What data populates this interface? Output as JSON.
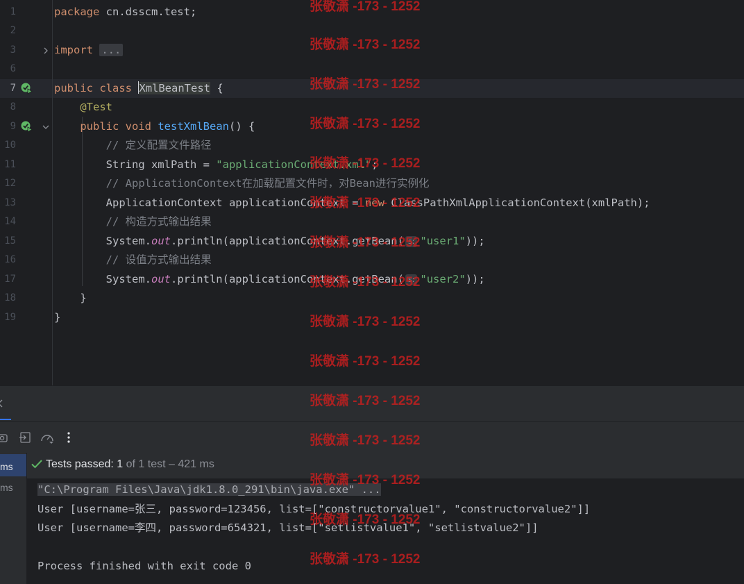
{
  "editor": {
    "lines": {
      "l1": {
        "num": "1"
      },
      "l2": {
        "num": "2"
      },
      "l3": {
        "num": "3"
      },
      "l6": {
        "num": "6"
      },
      "l7": {
        "num": "7"
      },
      "l8": {
        "num": "8"
      },
      "l9": {
        "num": "9"
      },
      "l10": {
        "num": "10"
      },
      "l11": {
        "num": "11"
      },
      "l12": {
        "num": "12"
      },
      "l13": {
        "num": "13"
      },
      "l14": {
        "num": "14"
      },
      "l15": {
        "num": "15"
      },
      "l16": {
        "num": "16"
      },
      "l17": {
        "num": "17"
      },
      "l18": {
        "num": "18"
      },
      "l19": {
        "num": "19"
      }
    },
    "code": {
      "package_kw": "package",
      "package_name": " cn.dsscm.test;",
      "import_kw": "import",
      "import_fold": "...",
      "public": "public",
      "class": "class",
      "class_name": "XmlBeanTest",
      "open_brace": " {",
      "annotation": "@Test",
      "void": "void",
      "method_name": "testXmlBean",
      "method_sig": "() {",
      "comment1": "// 定义配置文件路径",
      "string_type": "String xmlPath = ",
      "xml_path": "\"applicationContext.xml\"",
      "semi": ";",
      "comment2": "// ApplicationContext在加载配置文件时，对Bean进行实例化",
      "ctx_decl": "ApplicationContext applicationContext = ",
      "new_kw": "new",
      "ctx_new": " ClassPathXmlApplicationContext(xmlPath);",
      "comment3": "// 构造方式输出结果",
      "system": "System.",
      "out": "out",
      "println": ".println(applicationContext.getBean(",
      "param_hint": "s:",
      "user1": "\"user1\"",
      "close_call": "));",
      "comment4": "// 设值方式输出结果",
      "user2": "\"user2\"",
      "close_brace": "}"
    }
  },
  "test_panel": {
    "tree_items": [
      "ms",
      "ms"
    ],
    "status_passed": "Tests passed:",
    "status_count": "1",
    "status_rest": "of 1 test – 421 ms"
  },
  "console": {
    "cmd": "\"C:\\Program Files\\Java\\jdk1.8.0_291\\bin\\java.exe\" ...",
    "out1": "User [username=张三, password=123456, list=[\"constructorvalue1\", \"constructorvalue2\"]]",
    "out2": "User [username=李四, password=654321, list=[\"setlistvalue1\", \"setlistvalue2\"]]",
    "exit": "Process finished with exit code 0"
  },
  "watermark": "张敬潇 -173 - 1252",
  "colors": {
    "background": "#1e1f22",
    "keyword": "#cf8e6d",
    "string": "#6aab73",
    "function": "#56a8f5",
    "comment": "#7a7e85",
    "pass_green": "#5fb865",
    "watermark": "#c81e1e"
  }
}
